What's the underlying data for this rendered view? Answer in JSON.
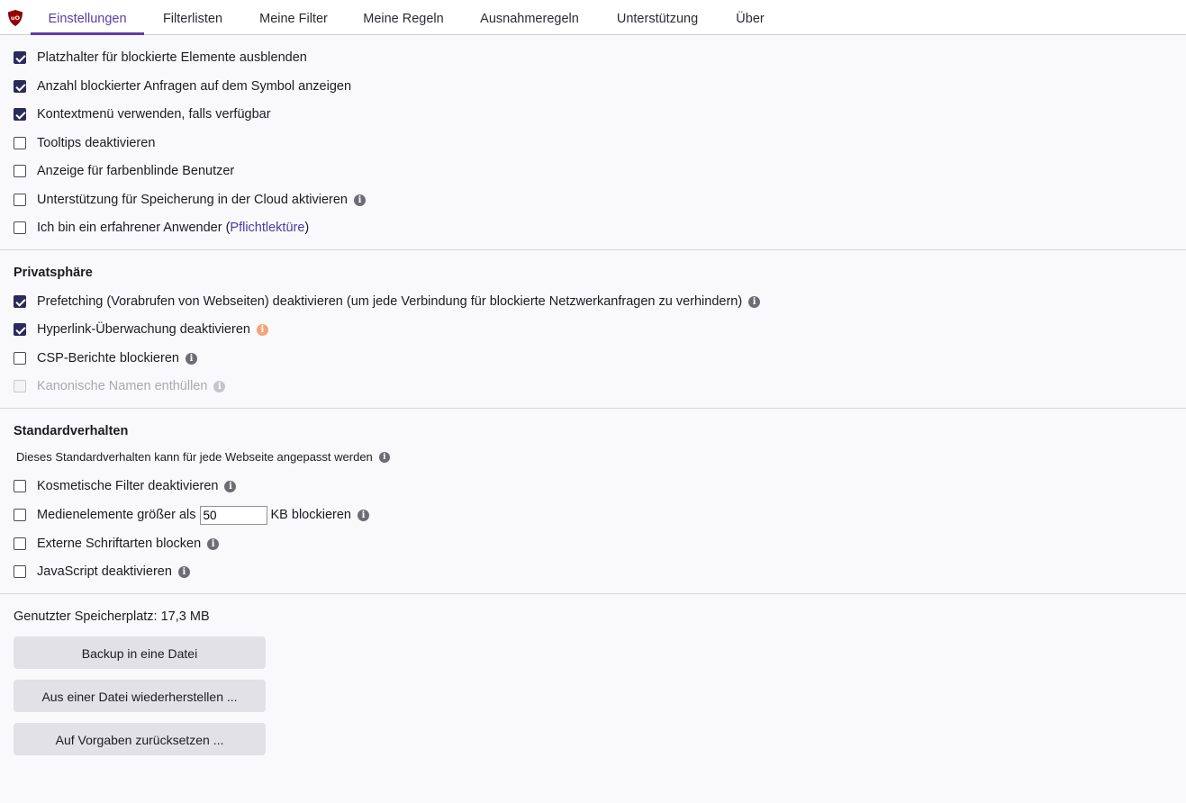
{
  "tabs": [
    {
      "label": "Einstellungen",
      "active": true
    },
    {
      "label": "Filterlisten"
    },
    {
      "label": "Meine Filter"
    },
    {
      "label": "Meine Regeln"
    },
    {
      "label": "Ausnahmeregeln"
    },
    {
      "label": "Unterstützung"
    },
    {
      "label": "Über"
    }
  ],
  "appearance": {
    "items": [
      {
        "label": "Platzhalter für blockierte Elemente ausblenden",
        "checked": true
      },
      {
        "label": "Anzahl blockierter Anfragen auf dem Symbol anzeigen",
        "checked": true
      },
      {
        "label": "Kontextmenü verwenden, falls verfügbar",
        "checked": true
      },
      {
        "label": "Tooltips deaktivieren",
        "checked": false
      },
      {
        "label": "Anzeige für farbenblinde Benutzer",
        "checked": false
      },
      {
        "label": "Unterstützung für Speicherung in der Cloud aktivieren",
        "checked": false
      },
      {
        "label": "Ich bin ein erfahrener Anwender (",
        "link": "Pflichtlektüre",
        "suffix": ")",
        "checked": false
      }
    ]
  },
  "privacy": {
    "title": "Privatsphäre",
    "items": [
      {
        "label": "Prefetching (Vorabrufen von Webseiten) deaktivieren (um jede Verbindung für blockierte Netzwerkanfragen zu verhindern)",
        "checked": true
      },
      {
        "label": "Hyperlink-Überwachung deaktivieren",
        "checked": true
      },
      {
        "label": "CSP-Berichte blockieren",
        "checked": false
      },
      {
        "label": "Kanonische Namen enthüllen",
        "checked": false,
        "disabled": true
      }
    ]
  },
  "defaults": {
    "title": "Standardverhalten",
    "note": "Dieses Standardverhalten kann für jede Webseite angepasst werden",
    "items": [
      {
        "label": "Kosmetische Filter deaktivieren",
        "checked": false
      },
      {
        "label": "Medienelemente größer als",
        "suffix": "KB blockieren",
        "value": "50",
        "checked": false
      },
      {
        "label": "Externe Schriftarten blocken",
        "checked": false
      },
      {
        "label": "JavaScript deaktivieren",
        "checked": false
      }
    ]
  },
  "storage": {
    "label": "Genutzter Speicherplatz: 17,3 MB",
    "backup_button": "Backup in eine Datei",
    "restore_button": "Aus einer Datei wiederherstellen ...",
    "reset_button": "Auf Vorgaben zurücksetzen ..."
  },
  "colors": {
    "accent": "#5b3ea6",
    "checkbox_checked": "#2b2a5c",
    "info_icon": "#6c6c74",
    "info_warning": "#f2a57a",
    "button_bg": "#e2e1e6"
  },
  "icons": {
    "logo": "ublock-shield-icon",
    "info": "info-circle-icon"
  }
}
